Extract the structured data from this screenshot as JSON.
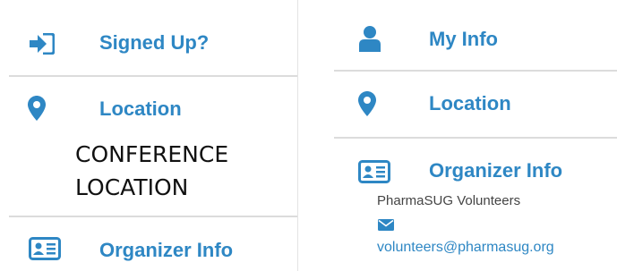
{
  "left": {
    "signed_up_label": "Signed Up?",
    "location_label": "Location",
    "location_text_line1": "CONFERENCE",
    "location_text_line2": "LOCATION",
    "organizer_label": "Organizer Info"
  },
  "right": {
    "my_info_label": "My Info",
    "location_label": "Location",
    "organizer_label": "Organizer Info",
    "organizer_name": "PharmaSUG Volunteers",
    "organizer_email": "volunteers@pharmasug.org"
  },
  "icons": {
    "signed_up": "sign-in-icon",
    "location": "map-marker-icon",
    "organizer": "id-card-icon",
    "my_info": "user-icon",
    "email": "envelope-icon"
  },
  "colors": {
    "accent": "#2e87c4",
    "divider": "#dcdcdc",
    "text": "#111111"
  }
}
